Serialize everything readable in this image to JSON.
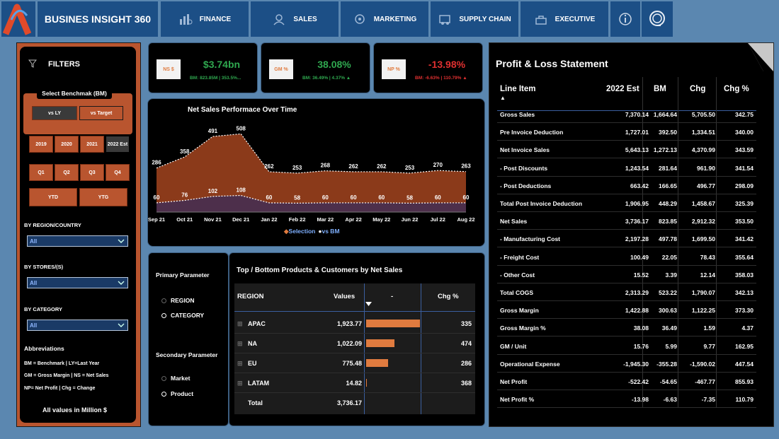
{
  "nav": {
    "brand": "BUSINES INSIGHT 360",
    "tabs": [
      {
        "label": "FINANCE",
        "icon": "finance-icon"
      },
      {
        "label": "SALES",
        "icon": "sales-icon"
      },
      {
        "label": "MARKETING",
        "icon": "marketing-icon"
      },
      {
        "label": "SUPPLY CHAIN",
        "icon": "supply-chain-icon"
      },
      {
        "label": "EXECUTIVE",
        "icon": "executive-icon"
      }
    ]
  },
  "filters": {
    "title": "FILTERS",
    "benchmark_label": "Select Benchmak (BM)",
    "bm_options": [
      "vs LY",
      "vs Target"
    ],
    "years": [
      "2019",
      "2020",
      "2021",
      "2022 Est"
    ],
    "quarters": [
      "Q1",
      "Q2",
      "Q3",
      "Q4"
    ],
    "periods": [
      "YTD",
      "YTG"
    ],
    "region_label": "BY REGION/COUNTRY",
    "region_value": "All",
    "stores_label": "BY STORES/(S)",
    "stores_value": "All",
    "category_label": "BY CATEGORY",
    "category_value": "All",
    "abbr_title": "Abbreviations",
    "abbr_lines": [
      "BM = Benchmark | LY=Last Year",
      "GM = Gross Margin | NS = Net Sales",
      "NP= Net Profit | Chg = Change"
    ],
    "units_note": "All values in Million $"
  },
  "kpis": [
    {
      "badge": "NS $",
      "value": "$3.74bn",
      "sub": "BM: 823.85M | 353.5%...",
      "color": "#2fa84f",
      "sub_color": "#2fa84f"
    },
    {
      "badge": "GM %",
      "value": "38.08%",
      "sub": "BM: 36.49% | 4.37% ▲",
      "color": "#2fa84f",
      "sub_color": "#2fa84f"
    },
    {
      "badge": "NP %",
      "value": "-13.98%",
      "sub": "BM: -6.63% | 110.79% ▲",
      "color": "#e03030",
      "sub_color": "#e03030"
    }
  ],
  "chart_data": {
    "type": "area",
    "title": "Net Sales Performace Over Time",
    "x": [
      "Sep 21",
      "Oct 21",
      "Nov 21",
      "Dec 21",
      "Jan 22",
      "Feb 22",
      "Mar 22",
      "Apr 22",
      "May 22",
      "Jun 22",
      "Jul 22",
      "Aug 22"
    ],
    "series": [
      {
        "name": "Selection",
        "values": [
          286,
          358,
          491,
          508,
          262,
          253,
          268,
          262,
          262,
          253,
          270,
          263
        ],
        "color": "#8b3a1a"
      },
      {
        "name": "vs BM",
        "values": [
          60,
          76,
          102,
          108,
          60,
          58,
          60,
          60,
          60,
          58,
          60,
          60
        ],
        "color": "#4a2e4e"
      }
    ],
    "ylim": [
      0,
      560
    ],
    "legend_position": "bottom"
  },
  "params": {
    "primary_label": "Primary Parameter",
    "primary_options": [
      "REGION",
      "CATEGORY"
    ],
    "secondary_label": "Secondary Parameter",
    "secondary_options": [
      "Market",
      "Product"
    ]
  },
  "top_bottom": {
    "title": "Top / Bottom Products & Customers by Net Sales",
    "headers": [
      "REGION",
      "Values",
      "-",
      "Chg %"
    ],
    "rows": [
      {
        "name": "APAC",
        "value": "1,923.77",
        "bar": 1923.77,
        "chg": "335"
      },
      {
        "name": "NA",
        "value": "1,022.09",
        "bar": 1022.09,
        "chg": "474"
      },
      {
        "name": "EU",
        "value": "775.48",
        "bar": 775.48,
        "chg": "286"
      },
      {
        "name": "LATAM",
        "value": "14.82",
        "bar": 14.82,
        "chg": "368"
      }
    ],
    "total": {
      "name": "Total",
      "value": "3,736.17"
    }
  },
  "pl": {
    "title": "Profit & Loss Statement",
    "headers": [
      "Line Item",
      "2022 Est",
      "BM",
      "Chg",
      "Chg %"
    ],
    "rows": [
      [
        "Gross Sales",
        "7,370.14",
        "1,664.64",
        "5,705.50",
        "342.75"
      ],
      [
        "Pre Invoice Deduction",
        "1,727.01",
        "392.50",
        "1,334.51",
        "340.00"
      ],
      [
        "Net Invoice Sales",
        "5,643.13",
        "1,272.13",
        "4,370.99",
        "343.59"
      ],
      [
        "- Post Discounts",
        "1,243.54",
        "281.64",
        "961.90",
        "341.54"
      ],
      [
        "- Post Deductions",
        "663.42",
        "166.65",
        "496.77",
        "298.09"
      ],
      [
        "Total Post Invoice Deduction",
        "1,906.95",
        "448.29",
        "1,458.67",
        "325.39"
      ],
      [
        "Net Sales",
        "3,736.17",
        "823.85",
        "2,912.32",
        "353.50"
      ],
      [
        "- Manufacturing Cost",
        "2,197.28",
        "497.78",
        "1,699.50",
        "341.42"
      ],
      [
        " - Freight Cost",
        "100.49",
        "22.05",
        "78.43",
        "355.64"
      ],
      [
        " - Other Cost",
        "15.52",
        "3.39",
        "12.14",
        "358.03"
      ],
      [
        "Total COGS",
        "2,313.29",
        "523.22",
        "1,790.07",
        "342.13"
      ],
      [
        "Gross Margin",
        "1,422.88",
        "300.63",
        "1,122.25",
        "373.30"
      ],
      [
        "Gross Margin %",
        "38.08",
        "36.49",
        "1.59",
        "4.37"
      ],
      [
        "GM / Unit",
        "15.76",
        "5.99",
        "9.77",
        "162.95"
      ],
      [
        "Operational Expense",
        "-1,945.30",
        "-355.28",
        "-1,590.02",
        "447.54"
      ],
      [
        "Net Profit",
        "-522.42",
        "-54.65",
        "-467.77",
        "855.93"
      ],
      [
        "Net Profit %",
        "-13.98",
        "-6.63",
        "-7.35",
        "110.79"
      ]
    ]
  }
}
